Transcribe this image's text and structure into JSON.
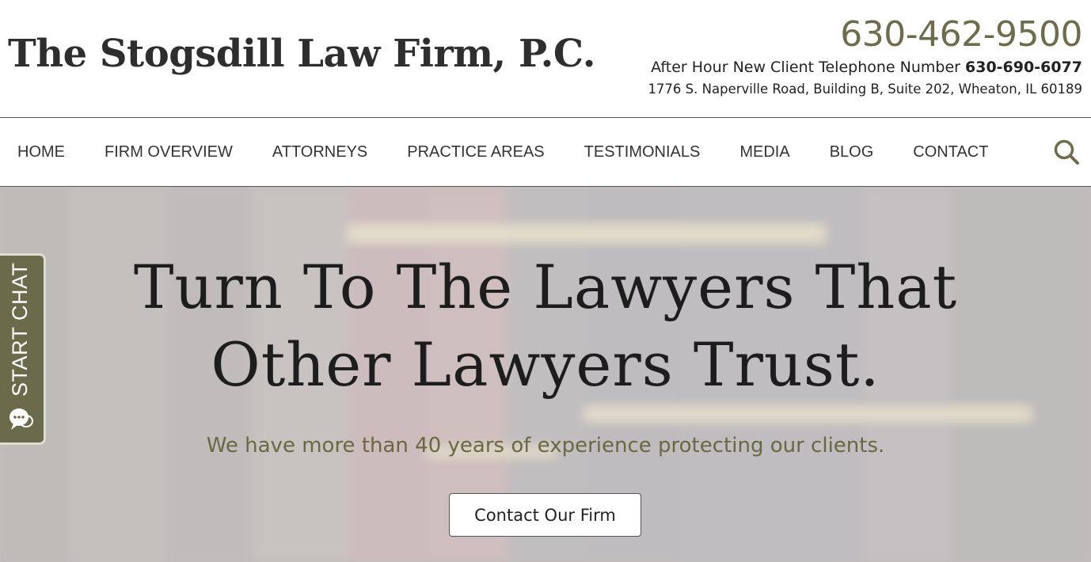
{
  "header": {
    "firm_name": "The Stogsdill Law Firm, P.C.",
    "main_phone": "630-462-9500",
    "after_hours_label": "After Hour New Client Telephone Number",
    "after_hours_phone": "630-690-6077",
    "address": "1776 S. Naperville Road, Building B, Suite 202, Wheaton, IL 60189"
  },
  "nav": {
    "items": [
      {
        "label": "HOME"
      },
      {
        "label": "FIRM OVERVIEW"
      },
      {
        "label": "ATTORNEYS"
      },
      {
        "label": "PRACTICE AREAS"
      },
      {
        "label": "TESTIMONIALS"
      },
      {
        "label": "MEDIA"
      },
      {
        "label": "BLOG"
      },
      {
        "label": "CONTACT"
      }
    ],
    "search_icon": "search-icon"
  },
  "hero": {
    "headline_line1": "Turn To The Lawyers That",
    "headline_line2": "Other Lawyers Trust.",
    "subhead": "We have more than 40 years of experience protecting our clients.",
    "cta_label": "Contact Our Firm"
  },
  "chat": {
    "label": "START CHAT",
    "icon": "chat-bubbles-icon"
  },
  "colors": {
    "accent": "#6e6c4c",
    "chat_tab": "#6b6a4a",
    "subhead": "#6a6841"
  }
}
